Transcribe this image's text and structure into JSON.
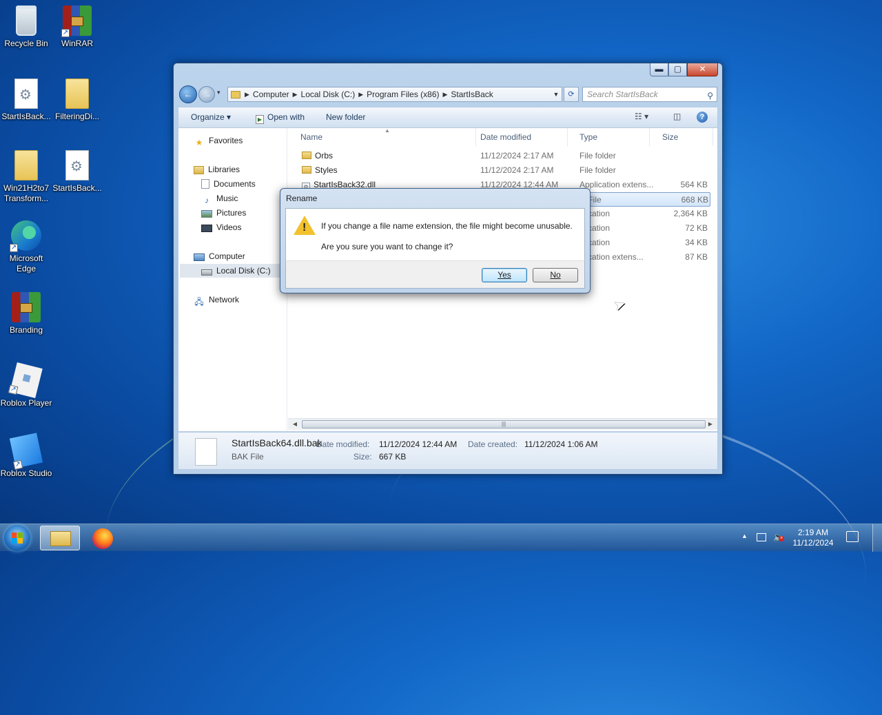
{
  "desktop": {
    "icons": [
      {
        "label": "Recycle Bin"
      },
      {
        "label": "WinRAR"
      },
      {
        "label": "StartIsBack..."
      },
      {
        "label": "FilteringDi..."
      },
      {
        "label": "Win21H2to7 Transform..."
      },
      {
        "label": "StartIsBack..."
      },
      {
        "label": "Microsoft Edge"
      },
      {
        "label": "Branding"
      },
      {
        "label": "Roblox Player"
      },
      {
        "label": "Roblox Studio"
      }
    ]
  },
  "explorer": {
    "caption": {
      "minimize": "▬",
      "maximize": "▢",
      "close": "✕"
    },
    "address": {
      "crumbs": [
        "Computer",
        "Local Disk (C:)",
        "Program Files (x86)",
        "StartIsBack"
      ]
    },
    "search_placeholder": "Search StartIsBack",
    "toolbar": {
      "organize": "Organize ▾",
      "open_with": "Open with",
      "new_folder": "New folder"
    },
    "nav": {
      "favorites": "Favorites",
      "libraries": "Libraries",
      "documents": "Documents",
      "music": "Music",
      "pictures": "Pictures",
      "videos": "Videos",
      "computer": "Computer",
      "local_disk": "Local Disk (C:)",
      "network": "Network"
    },
    "columns": {
      "name": "Name",
      "date": "Date modified",
      "type": "Type",
      "size": "Size"
    },
    "files": [
      {
        "name": "Orbs",
        "date": "11/12/2024 2:17 AM",
        "type": "File folder",
        "size": ""
      },
      {
        "name": "Styles",
        "date": "11/12/2024 2:17 AM",
        "type": "File folder",
        "size": ""
      },
      {
        "name": "StartIsBack32.dll",
        "date": "11/12/2024 12:44 AM",
        "type": "Application extens...",
        "size": "564 KB"
      },
      {
        "name": "",
        "date": "",
        "type": "K File",
        "size": "668 KB"
      },
      {
        "name": "",
        "date": "",
        "type": "plication",
        "size": "2,364 KB"
      },
      {
        "name": "",
        "date": "",
        "type": "plication",
        "size": "72 KB"
      },
      {
        "name": "",
        "date": "",
        "type": "plication",
        "size": "34 KB"
      },
      {
        "name": "",
        "date": "",
        "type": "plication extens...",
        "size": "87 KB"
      }
    ],
    "details": {
      "filename": "StartIsBack64.dll.bak",
      "filetype": "BAK File",
      "date_modified_label": "Date modified:",
      "date_modified": "11/12/2024 12:44 AM",
      "date_created_label": "Date created:",
      "date_created": "11/12/2024 1:06 AM",
      "size_label": "Size:",
      "size": "667 KB"
    }
  },
  "dialog": {
    "title": "Rename",
    "message": "If you change a file name extension, the file might become unusable.",
    "question": "Are you sure you want to change it?",
    "yes": "Yes",
    "no": "No"
  },
  "taskbar": {
    "time": "2:19 AM",
    "date": "11/12/2024"
  }
}
